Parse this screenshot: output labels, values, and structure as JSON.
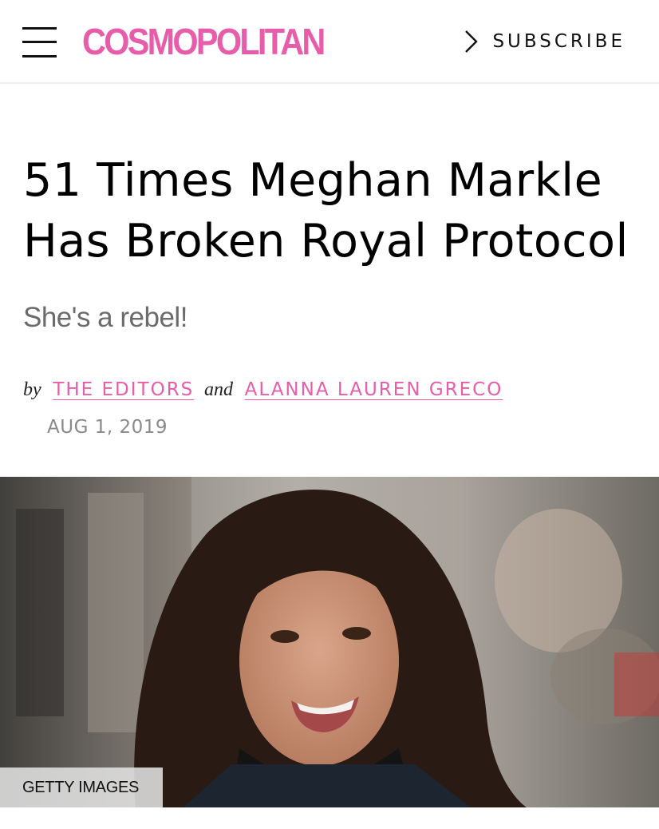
{
  "header": {
    "logo_text": "COSMOPOLITAN",
    "subscribe_label": "SUBSCRIBE",
    "brand_color": "#e85da9"
  },
  "article": {
    "headline": "51 Times Meghan Markle Has Broken Royal Protocol",
    "dek": "She's a rebel!",
    "byline": {
      "by": "by",
      "and": "and",
      "author_1": "THE EDITORS",
      "author_2": "ALANNA LAUREN GRECO"
    },
    "date": "AUG 1, 2019",
    "hero_image": {
      "credit": "GETTY IMAGES"
    }
  }
}
